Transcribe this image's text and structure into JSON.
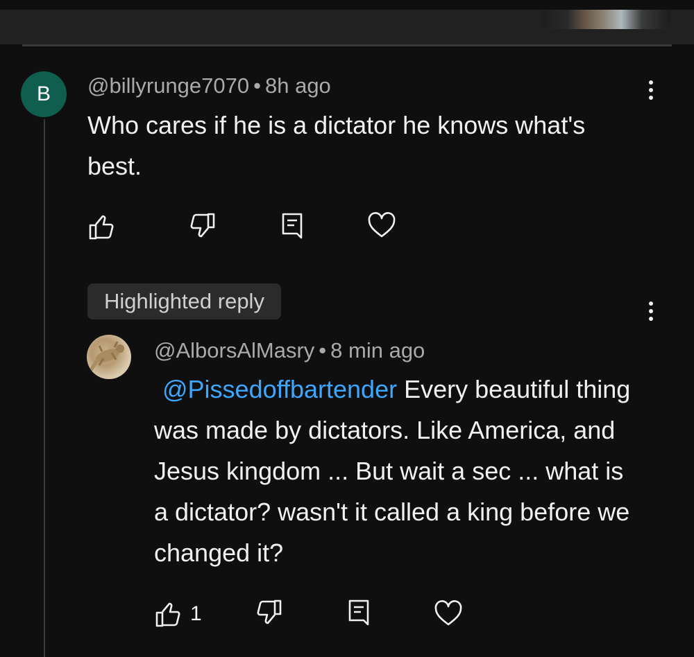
{
  "comment": {
    "avatar_letter": "B",
    "author": "@billyrunge7070",
    "separator": "•",
    "time": "8h ago",
    "text": "Who cares if he is a dictator he knows what's best."
  },
  "reply": {
    "badge": "Highlighted reply",
    "author": "@AlborsAlMasry",
    "separator": "•",
    "time": "8 min ago",
    "mention": "@Pissedoffbartender",
    "text": "Every beautiful thing was made by dictators. Like America, and Jesus kingdom ... But wait a sec ... what is a dictator? wasn't it called a king before we changed it?",
    "like_count": "1"
  },
  "colors": {
    "background": "#0f0f0f",
    "mention": "#3ea6ff",
    "avatar": "#0f5e4f"
  },
  "icons": [
    "thumbs-up-icon",
    "thumbs-down-icon",
    "reply-icon",
    "heart-icon",
    "more-vert-icon"
  ]
}
